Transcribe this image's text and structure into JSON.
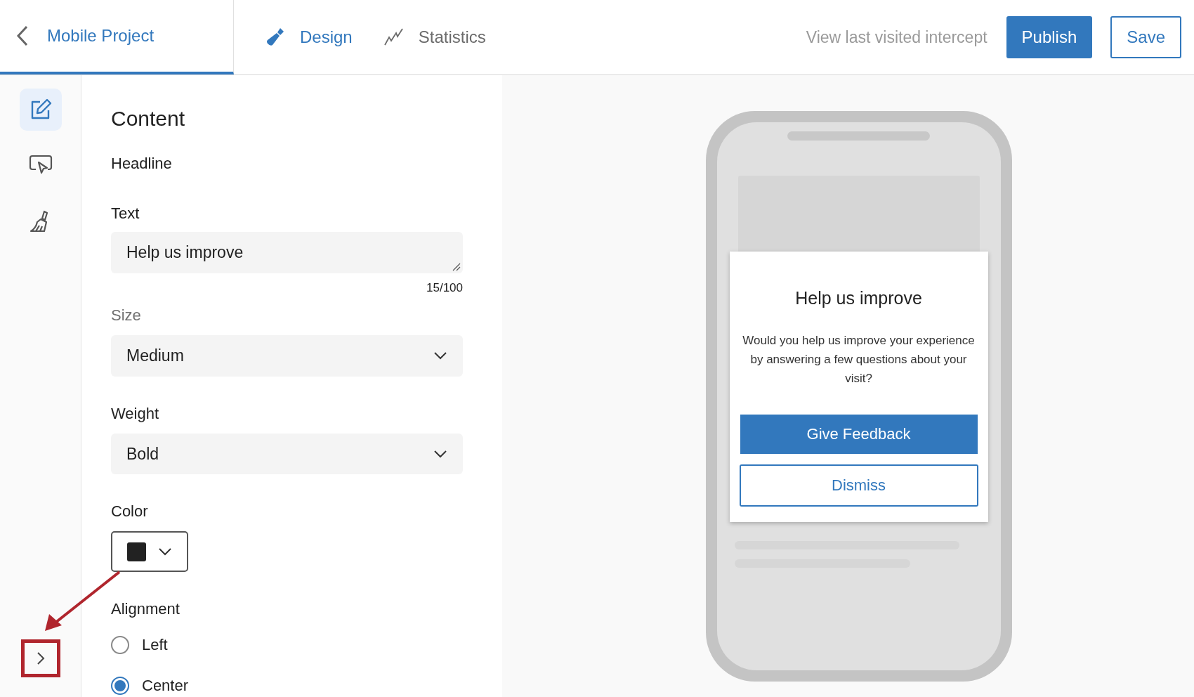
{
  "project": {
    "title": "Mobile Project"
  },
  "tabs": [
    {
      "label": "Design",
      "selected": true,
      "kind": "design"
    },
    {
      "label": "Statistics",
      "selected": false,
      "kind": "statistics"
    }
  ],
  "header_actions": {
    "link": "View last visited intercept",
    "publish": "Publish",
    "save": "Save"
  },
  "rail": [
    {
      "kind": "edit",
      "selected": true
    },
    {
      "kind": "pointer",
      "selected": false
    },
    {
      "kind": "brush",
      "selected": false
    }
  ],
  "panel": {
    "title": "Content",
    "section": "Headline",
    "text_label": "Text",
    "text_value": "Help us improve",
    "counter": "15/100",
    "size_label": "Size",
    "size_value": "Medium",
    "weight_label": "Weight",
    "weight_value": "Bold",
    "color_label": "Color",
    "color": "#222222",
    "alignment_label": "Alignment",
    "alignment_options": [
      {
        "label": "Left",
        "selected": false
      },
      {
        "label": "Center",
        "selected": true
      }
    ]
  },
  "preview": {
    "headline": "Help us improve",
    "body": "Would you help us improve your experience by answering a few questions about your visit?",
    "primary_button": "Give Feedback",
    "secondary_button": "Dismiss"
  }
}
